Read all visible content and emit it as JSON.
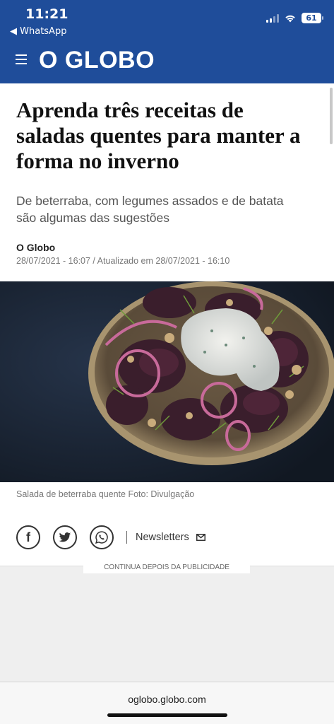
{
  "status_bar": {
    "time": "11:21",
    "back_app": "◀ WhatsApp",
    "battery": "61"
  },
  "header": {
    "logo": "O GLOBO",
    "brand_color": "#1f4d9a"
  },
  "article": {
    "headline": "Aprenda três receitas de saladas quentes para manter a forma no inverno",
    "subtitle": "De beterraba, com legumes assados e de batata são algumas das sugestões",
    "author": "O Globo",
    "dateline": "28/07/2021 - 16:07 / Atualizado em 28/07/2021 - 16:10",
    "photo_caption": "Salada de beterraba quente Foto: Divulgação"
  },
  "share": {
    "facebook_icon": "facebook-icon",
    "twitter_icon": "twitter-icon",
    "whatsapp_icon": "whatsapp-icon",
    "newsletters_label": "Newsletters"
  },
  "ad": {
    "label": "CONTINUA DEPOIS DA PUBLICIDADE"
  },
  "browser": {
    "url": "oglobo.globo.com"
  }
}
